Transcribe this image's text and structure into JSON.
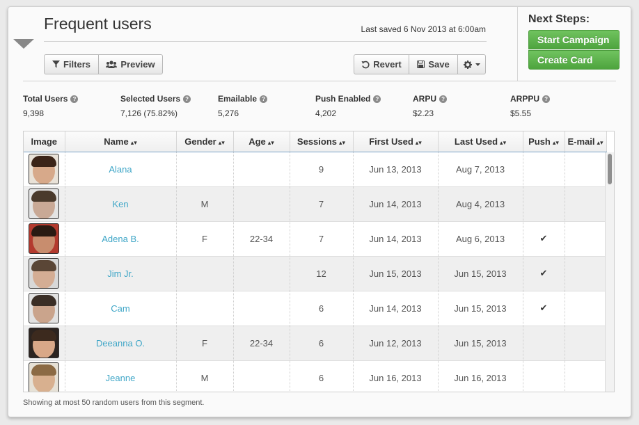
{
  "header": {
    "title": "Frequent users",
    "last_saved": "Last saved 6 Nov 2013 at 6:00am"
  },
  "toolbar": {
    "filters_label": "Filters",
    "preview_label": "Preview",
    "revert_label": "Revert",
    "save_label": "Save"
  },
  "next_steps": {
    "title": "Next Steps:",
    "start_campaign_label": "Start Campaign",
    "create_card_label": "Create Card"
  },
  "stats": [
    {
      "label": "Total Users",
      "value": "9,398"
    },
    {
      "label": "Selected Users",
      "value": "7,126 (75.82%)"
    },
    {
      "label": "Emailable",
      "value": "5,276"
    },
    {
      "label": "Push Enabled",
      "value": "4,202"
    },
    {
      "label": "ARPU",
      "value": "$2.23"
    },
    {
      "label": "ARPPU",
      "value": "$5.55"
    }
  ],
  "table": {
    "columns": [
      "Image",
      "Name",
      "Gender",
      "Age",
      "Sessions",
      "First Used",
      "Last Used",
      "Push",
      "E-mail"
    ],
    "rows": [
      {
        "name": "Alana",
        "gender": "",
        "age": "",
        "sessions": "9",
        "first_used": "Jun 13, 2013",
        "last_used": "Aug 7, 2013",
        "push": "",
        "email": ""
      },
      {
        "name": "Ken",
        "gender": "M",
        "age": "",
        "sessions": "7",
        "first_used": "Jun 14, 2013",
        "last_used": "Aug 4, 2013",
        "push": "",
        "email": ""
      },
      {
        "name": "Adena B.",
        "gender": "F",
        "age": "22-34",
        "sessions": "7",
        "first_used": "Jun 14, 2013",
        "last_used": "Aug 6, 2013",
        "push": "✔",
        "email": ""
      },
      {
        "name": "Jim Jr.",
        "gender": "",
        "age": "",
        "sessions": "12",
        "first_used": "Jun 15, 2013",
        "last_used": "Jun 15, 2013",
        "push": "✔",
        "email": ""
      },
      {
        "name": "Cam",
        "gender": "",
        "age": "",
        "sessions": "6",
        "first_used": "Jun 14, 2013",
        "last_used": "Jun 15, 2013",
        "push": "✔",
        "email": ""
      },
      {
        "name": "Deeanna O.",
        "gender": "F",
        "age": "22-34",
        "sessions": "6",
        "first_used": "Jun 12, 2013",
        "last_used": "Jun 15, 2013",
        "push": "",
        "email": ""
      },
      {
        "name": "Jeanne",
        "gender": "M",
        "age": "",
        "sessions": "6",
        "first_used": "Jun 16, 2013",
        "last_used": "Jun 16, 2013",
        "push": "",
        "email": ""
      }
    ]
  },
  "footnote": "Showing at most 50 random users from this segment.",
  "colors": {
    "accent_link": "#3fa6c7",
    "next_step_green": "#5cb24b"
  }
}
